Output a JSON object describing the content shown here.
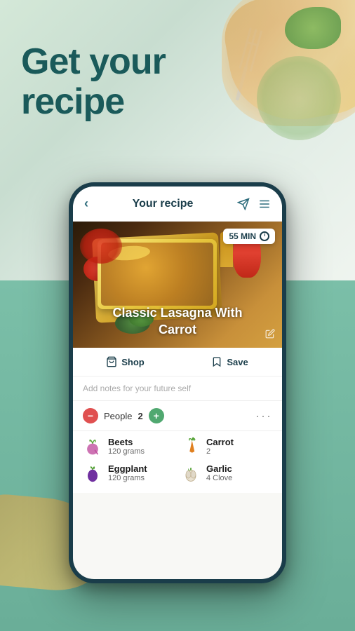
{
  "hero": {
    "title_line1": "Get your",
    "title_line2": "recipe"
  },
  "phone": {
    "header": {
      "back_label": "‹",
      "title": "Your recipe",
      "send_icon": "send",
      "menu_icon": "menu"
    },
    "recipe": {
      "time": "55 MIN",
      "title_line1": "Classic Lasagna With",
      "title_line2": "Carrot"
    },
    "actions": {
      "shop_label": "Shop",
      "save_label": "Save"
    },
    "notes": {
      "placeholder": "Add notes for your future self"
    },
    "people": {
      "label": "People",
      "count": "2"
    },
    "ingredients": [
      {
        "name": "Beets",
        "amount": "120 grams",
        "icon": "beet"
      },
      {
        "name": "Carrot",
        "amount": "2",
        "icon": "carrot"
      },
      {
        "name": "Eggplant",
        "amount": "120 grams",
        "icon": "eggplant"
      },
      {
        "name": "Garlic",
        "amount": "4 Clove",
        "icon": "garlic"
      }
    ]
  }
}
